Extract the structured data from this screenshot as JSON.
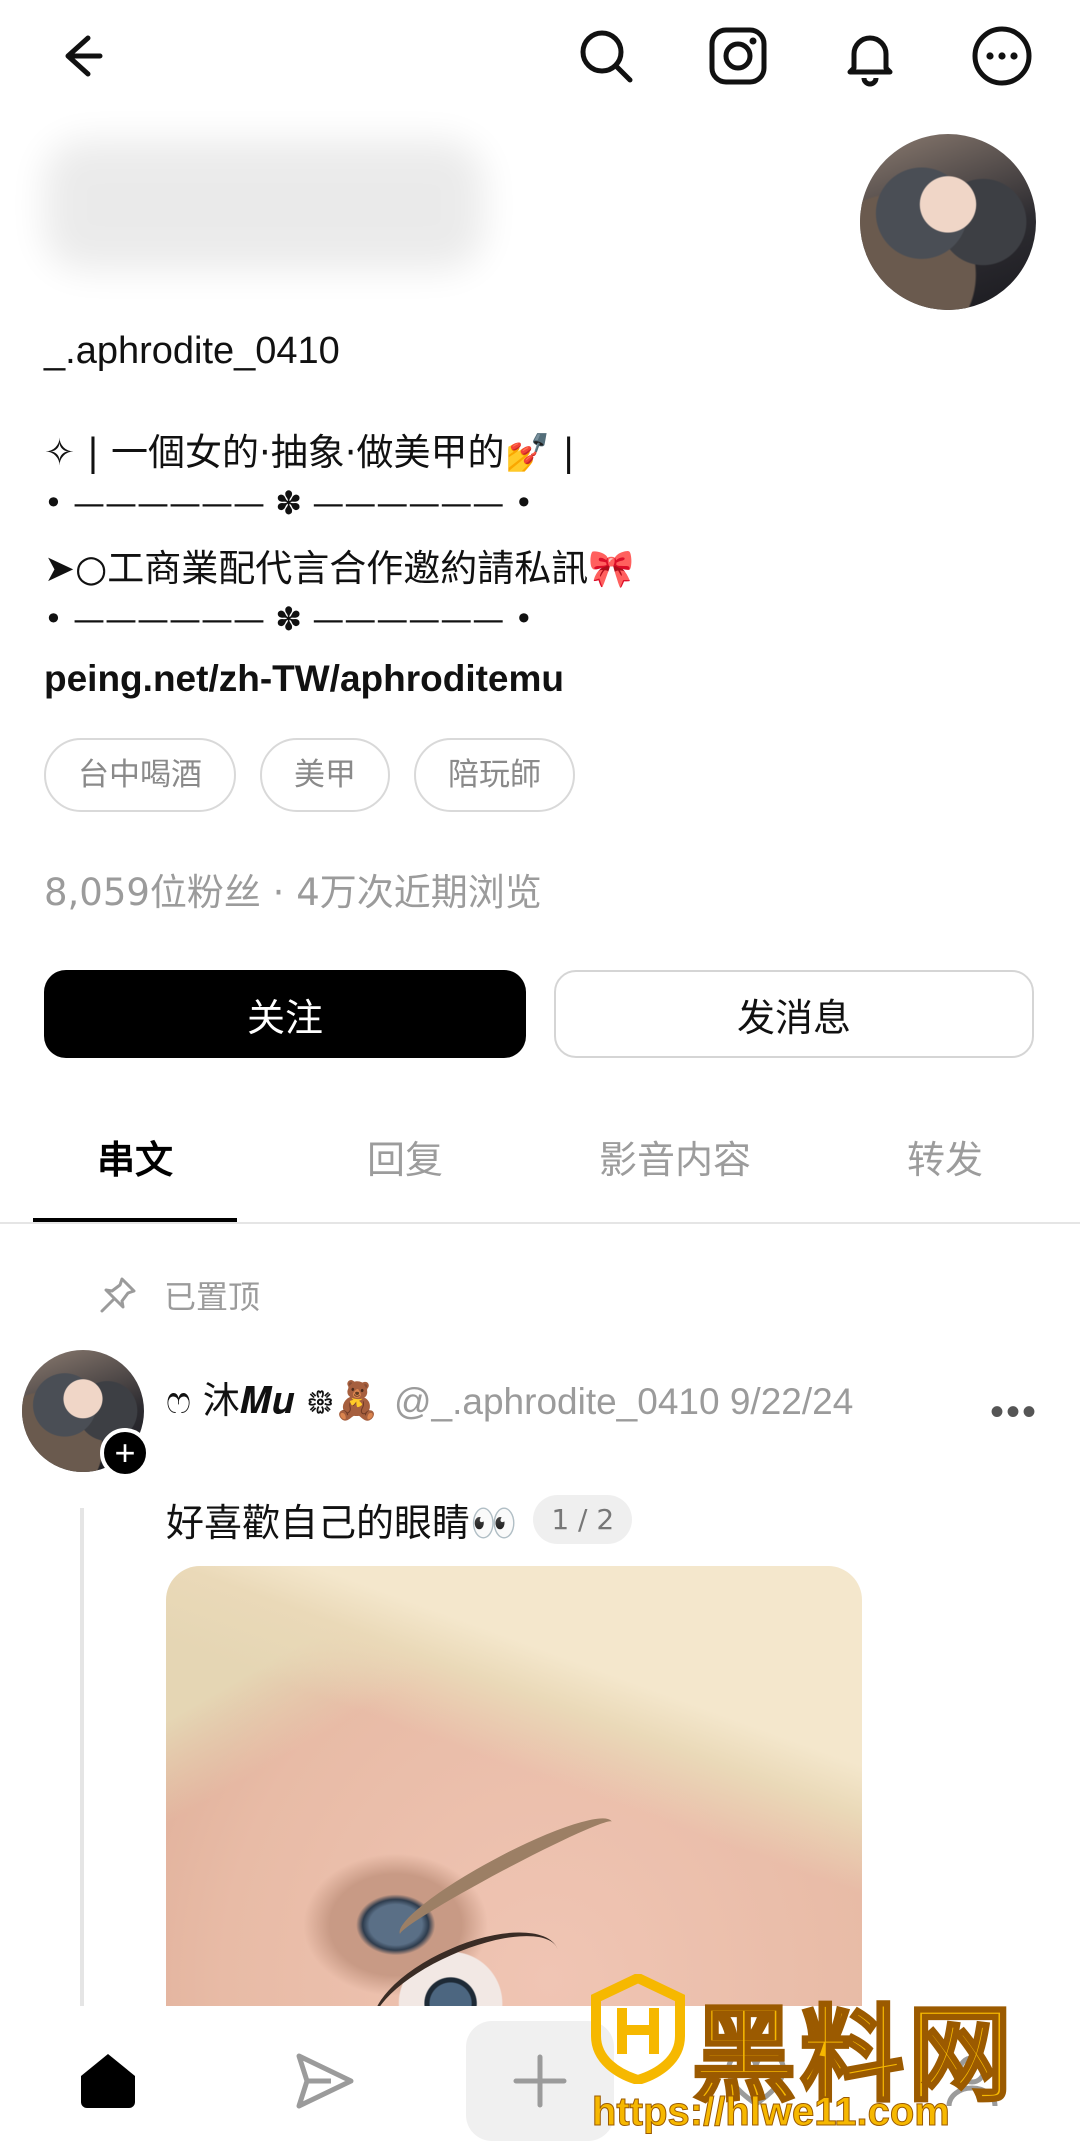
{
  "header": {
    "back_icon": "arrow-left-icon",
    "actions": [
      "search-icon",
      "instagram-icon",
      "bell-icon",
      "more-circle-icon"
    ]
  },
  "profile": {
    "username": "_.aphrodite_0410",
    "bio": [
      "✧ | 一個女的·抽象·做美甲的💅 |",
      "• —————— ✽ —————— •",
      "➤○工商業配代言合作邀約請私訊🎀",
      "• —————— ✽ —————— •"
    ],
    "link": "peing.net/zh-TW/aphroditemu",
    "tags": [
      "台中喝酒",
      "美甲",
      "陪玩師"
    ],
    "stats": "8,059位粉丝 · 4万次近期浏览"
  },
  "buttons": {
    "follow": "关注",
    "message": "发消息"
  },
  "tabs": [
    {
      "label": "串文",
      "active": true
    },
    {
      "label": "回复",
      "active": false
    },
    {
      "label": "影音内容",
      "active": false
    },
    {
      "label": "转发",
      "active": false
    }
  ],
  "pinned_label": "已置顶",
  "post": {
    "display_name": "ෆ 沐𝑴𝒖 ᪥🧸",
    "meta": "@_.aphrodite_0410 9/22/24",
    "text": "好喜歡自己的眼睛👀",
    "page_indicator": "1 / 2"
  },
  "bottom_nav": [
    "home-icon",
    "send-icon",
    "plus-icon",
    "heart-icon",
    "profile-icon"
  ],
  "watermark": {
    "brand": "黑料网",
    "url": "https://hlwe11.com"
  },
  "colors": {
    "primary": "#000000",
    "muted": "#9b9b9b",
    "border": "#d9d9d9",
    "watermark": "#f6b800"
  }
}
